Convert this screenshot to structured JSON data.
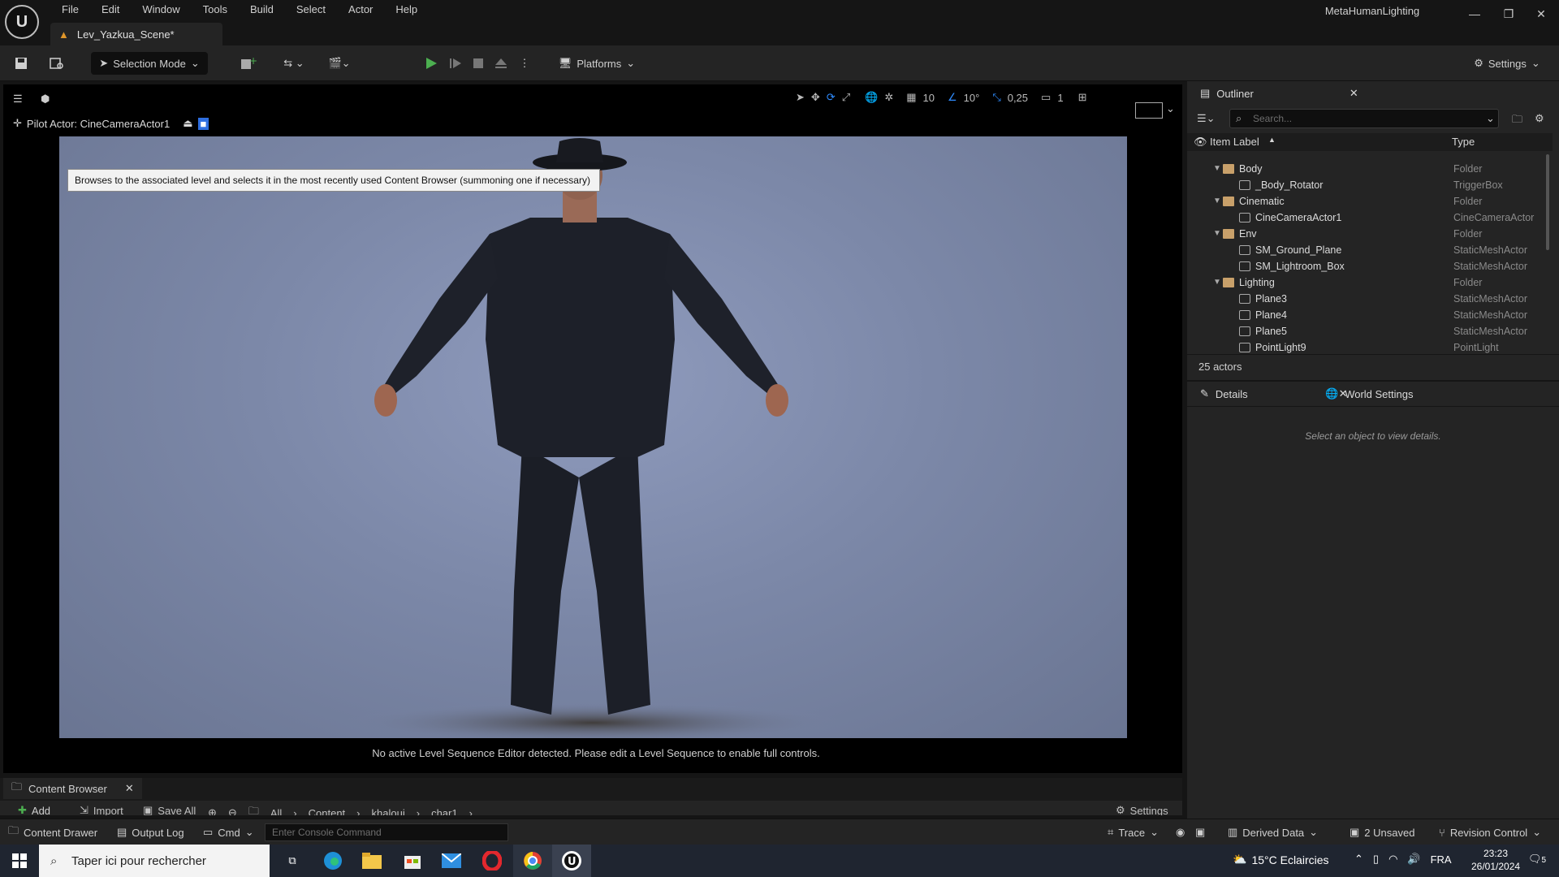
{
  "menu": [
    "File",
    "Edit",
    "Window",
    "Tools",
    "Build",
    "Select",
    "Actor",
    "Help"
  ],
  "level_tab": "Lev_Yazkua_Scene*",
  "project_title": "MetaHumanLighting",
  "toolbar": {
    "selection_mode": "Selection Mode",
    "platforms": "Platforms",
    "settings": "Settings"
  },
  "viewport": {
    "grid_snap": "10",
    "rotation_snap": "10°",
    "scale_snap": "0,25",
    "camera_speed": "1",
    "tooltip": "Browses to the associated level and selects it in the most recently used Content Browser (summoning one if necessary)",
    "pilot_actor": "Pilot Actor: CineCameraActor1",
    "sequence_message": "No active Level Sequence Editor detected. Please edit a Level Sequence to enable full controls."
  },
  "content_browser": {
    "tab": "Content Browser",
    "add": "Add",
    "import": "Import",
    "save_all": "Save All",
    "path": [
      "All",
      "Content",
      "khaloui",
      "char1"
    ],
    "settings": "Settings"
  },
  "status_bar": {
    "content_drawer": "Content Drawer",
    "output_log": "Output Log",
    "cmd": "Cmd",
    "console_placeholder": "Enter Console Command",
    "trace": "Trace",
    "derived_data": "Derived Data",
    "unsaved": "2 Unsaved",
    "revision_control": "Revision Control"
  },
  "outliner": {
    "title": "Outliner",
    "search_placeholder": "Search...",
    "col_label": "Item Label",
    "col_type": "Type",
    "rows": [
      {
        "name": "Body",
        "type": "Folder",
        "folder": true
      },
      {
        "name": "_Body_Rotator",
        "type": "TriggerBox",
        "folder": false
      },
      {
        "name": "Cinematic",
        "type": "Folder",
        "folder": true
      },
      {
        "name": "CineCameraActor1",
        "type": "CineCameraActor",
        "folder": false
      },
      {
        "name": "Env",
        "type": "Folder",
        "folder": true
      },
      {
        "name": "SM_Ground_Plane",
        "type": "StaticMeshActor",
        "folder": false
      },
      {
        "name": "SM_Lightroom_Box",
        "type": "StaticMeshActor",
        "folder": false
      },
      {
        "name": "Lighting",
        "type": "Folder",
        "folder": true
      },
      {
        "name": "Plane3",
        "type": "StaticMeshActor",
        "folder": false
      },
      {
        "name": "Plane4",
        "type": "StaticMeshActor",
        "folder": false
      },
      {
        "name": "Plane5",
        "type": "StaticMeshActor",
        "folder": false
      },
      {
        "name": "PointLight9",
        "type": "PointLight",
        "folder": false
      }
    ],
    "count": "25 actors"
  },
  "details": {
    "tab": "Details",
    "world_tab": "World Settings",
    "empty_message": "Select an object to view details."
  },
  "taskbar": {
    "search": "Taper ici pour rechercher",
    "weather": "15°C  Eclaircies",
    "lang": "FRA",
    "time": "23:23",
    "date": "26/01/2024",
    "notifications": "5"
  },
  "colors": {
    "accent": "#0070e0",
    "play_green": "#4caf50",
    "bg": "#151515",
    "panel": "#242424"
  }
}
